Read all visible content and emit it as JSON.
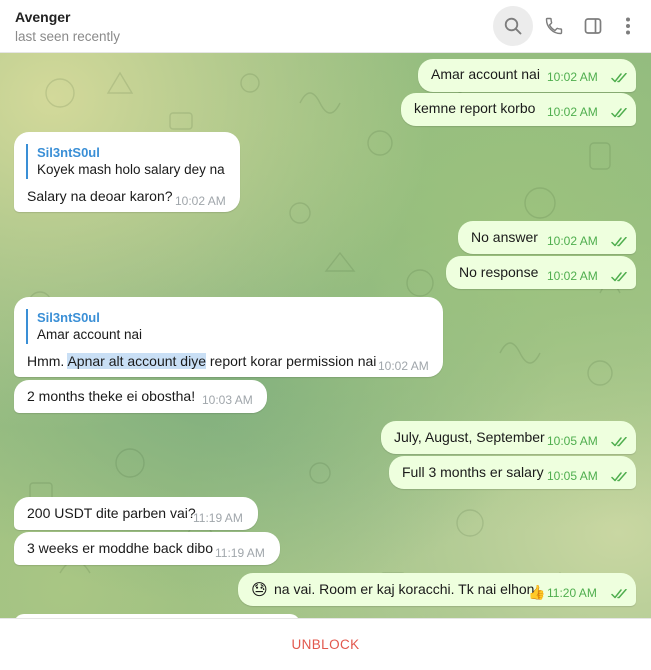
{
  "header": {
    "title": "Avenger",
    "status": "last seen recently",
    "icons": [
      "search-icon",
      "phone-icon",
      "sidebar-icon",
      "more-icon"
    ]
  },
  "messages": {
    "m1": {
      "text": "Amar account nai",
      "time": "10:02 AM"
    },
    "m2": {
      "text": "kemne report korbo",
      "time": "10:02 AM"
    },
    "m3": {
      "reply_author": "Sil3ntS0ul",
      "reply_text": "Koyek mash holo salary dey na",
      "text": "Salary na deoar karon?",
      "time": "10:02 AM"
    },
    "m4": {
      "text": "No answer",
      "time": "10:02 AM"
    },
    "m5": {
      "text": "No response",
      "time": "10:02 AM"
    },
    "m6": {
      "reply_author": "Sil3ntS0ul",
      "reply_text": "Amar account nai",
      "text_pre": "Hmm. ",
      "text_highlight": "Apnar alt account diye",
      "text_post": " report korar permission nai",
      "time": "10:02 AM"
    },
    "m7": {
      "text": "2 months theke ei obostha!",
      "time": "10:03 AM"
    },
    "m8": {
      "text": "July, August, September",
      "time": "10:05 AM"
    },
    "m9": {
      "text": "Full 3 months er salary",
      "time": "10:05 AM"
    },
    "m10": {
      "text": "200 USDT dite parben vai?",
      "time": "11:19 AM"
    },
    "m11": {
      "text": "3 weeks er moddhe back dibo",
      "time": "11:19 AM"
    },
    "m12": {
      "emoji": "😓",
      "text": "na vai. Room er kaj koracchi. Tk nai elhon",
      "reaction": "👍",
      "time": "11:20 AM"
    }
  },
  "footer": {
    "unblock_label": "UNBLOCK"
  },
  "colors": {
    "accent_blue": "#3a8fd6",
    "outgoing_bubble": "#eeffde",
    "outgoing_time": "#4fae4e",
    "unblock_red": "#e2574c"
  }
}
